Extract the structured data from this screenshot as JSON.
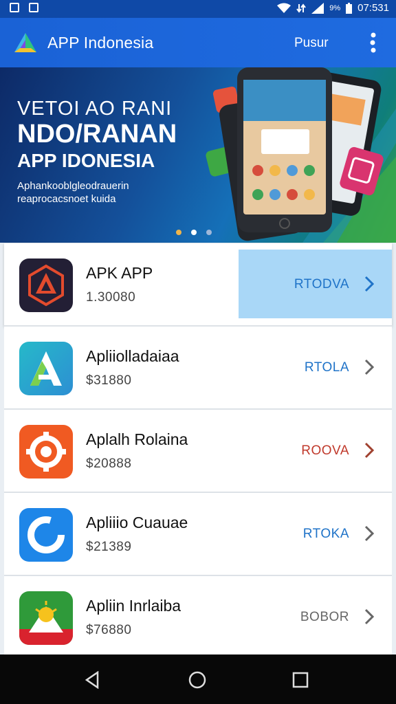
{
  "status_bar": {
    "battery_text": "9%",
    "time": "07:531"
  },
  "app_bar": {
    "title": "APP Indonesia",
    "action_label": "Pusur"
  },
  "banner": {
    "line1": "VETOI AO RANI",
    "line2": "NDO/RANAN",
    "line3": "APP IDONESIA",
    "sub1": "Aphankooblgleodrauerin",
    "sub2": "reaprocacsnoet kuida",
    "active_dot": 0
  },
  "apps": [
    {
      "name": "APK APP",
      "size": "1.30080",
      "action": "RTODVA",
      "action_color": "#1f73c8",
      "icon": "apk-icon",
      "selected": true
    },
    {
      "name": "Apliiolladaiaa",
      "size": "$31880",
      "action": "RTOLA",
      "action_color": "#1f73c8",
      "icon": "android-a-icon",
      "selected": false
    },
    {
      "name": "Aplalh Rolaina",
      "size": "$20888",
      "action": "ROOVA",
      "action_color": "#c0392b",
      "icon": "gear-app-icon",
      "selected": false
    },
    {
      "name": "Apliiio Cuauae",
      "size": "$21389",
      "action": "RTOKA",
      "action_color": "#1f73c8",
      "icon": "ring-app-icon",
      "selected": false
    },
    {
      "name": "Apliin Inrlaiba",
      "size": "$76880",
      "action": "BOBOR",
      "action_color": "#666666",
      "icon": "indonesia-app-icon",
      "selected": false
    }
  ],
  "colors": {
    "app_bar": "#1a62d6",
    "status_bar": "#0f49a7",
    "highlight": "#a9d7f7"
  }
}
